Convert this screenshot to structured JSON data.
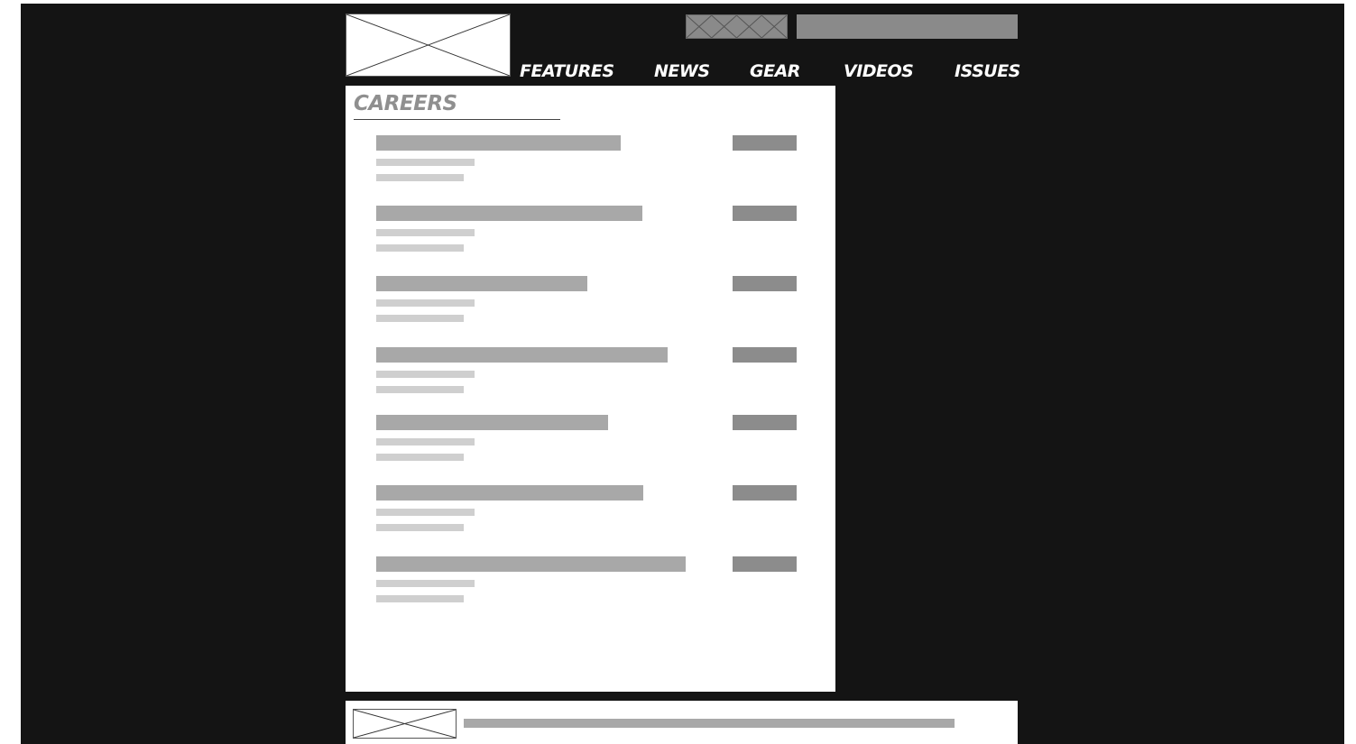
{
  "header": {
    "logo_icon": "image-placeholder-icon",
    "ad_icon": "image-placeholder-icon",
    "search_placeholder": ""
  },
  "nav": {
    "items": [
      {
        "label": "FEATURES"
      },
      {
        "label": "NEWS"
      },
      {
        "label": "GEAR"
      },
      {
        "label": "VIDEOS"
      },
      {
        "label": "ISSUES"
      }
    ]
  },
  "main": {
    "title": "CAREERS",
    "jobs_count_visible": 7
  },
  "colors": {
    "background": "#141414",
    "panel": "#ffffff",
    "title": "#8f8f8f",
    "placeholder_dark": "#8c8c8c",
    "placeholder_mid": "#a8a8a8",
    "placeholder_light": "#cfcfcf"
  },
  "footer": {
    "image_icon": "image-placeholder-icon"
  }
}
